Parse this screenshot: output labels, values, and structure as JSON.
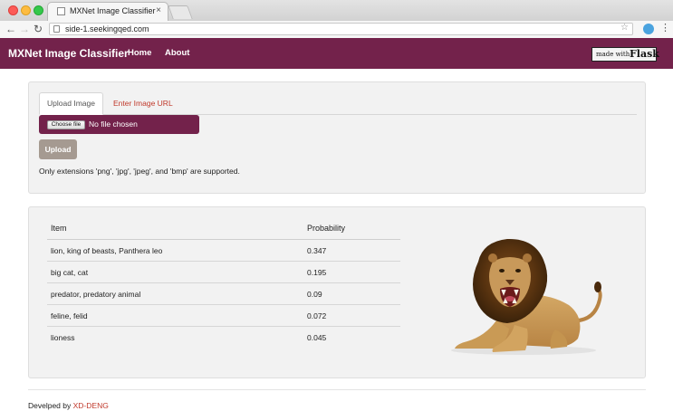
{
  "browser": {
    "tab_title": "MXNet Image Classifier",
    "tab_close": "×",
    "url": "side-1.seekingqed.com"
  },
  "navbar": {
    "brand": "MXNet Image Classifier",
    "links": [
      {
        "label": "Home"
      },
      {
        "label": "About"
      }
    ],
    "badge": {
      "small": "made with",
      "big": "Flask"
    }
  },
  "upload": {
    "tabs": [
      {
        "label": "Upload Image",
        "active": true
      },
      {
        "label": "Enter Image URL",
        "active": false
      }
    ],
    "choose_file_label": "Choose file",
    "file_status": "No file chosen",
    "upload_button": "Upload",
    "note": "Only extensions 'png', 'jpg', 'jpeg', and 'bmp' are supported."
  },
  "results": {
    "columns": [
      "Item",
      "Probability"
    ],
    "rows": [
      {
        "item": "lion, king of beasts, Panthera leo",
        "probability": "0.347"
      },
      {
        "item": "big cat, cat",
        "probability": "0.195"
      },
      {
        "item": "predator, predatory animal",
        "probability": "0.09"
      },
      {
        "item": "feline, felid",
        "probability": "0.072"
      },
      {
        "item": "lioness",
        "probability": "0.045"
      }
    ]
  },
  "footer": {
    "prefix": "Develped by ",
    "author": "XD-DENG"
  },
  "colors": {
    "brand": "#73224b",
    "panel": "#f2f2f2",
    "link_red": "#c0392b",
    "upload_btn": "#a59a91"
  }
}
